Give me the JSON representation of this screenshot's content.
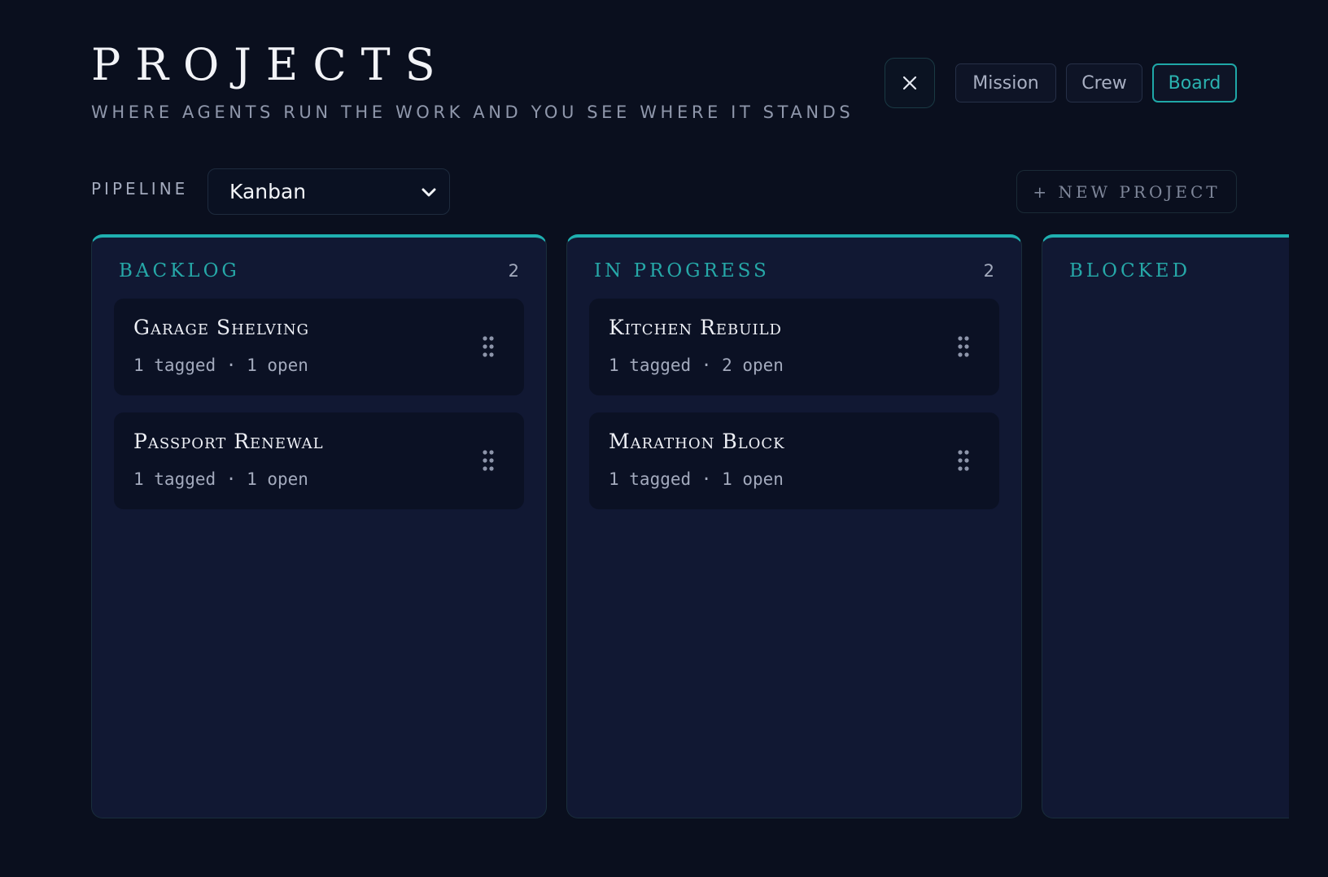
{
  "header": {
    "title": "PROJECTS",
    "subtitle": "WHERE AGENTS RUN THE WORK AND YOU SEE WHERE IT STANDS"
  },
  "nav": {
    "close_icon": "close-icon",
    "buttons": [
      {
        "label": "Mission",
        "active": false
      },
      {
        "label": "Crew",
        "active": false
      },
      {
        "label": "Board",
        "active": true
      }
    ]
  },
  "toolbar": {
    "pipeline_label": "PIPELINE",
    "pipeline_value": "Kanban",
    "new_project_label": "+ NEW PROJECT"
  },
  "colors": {
    "accent": "#1fb0b0",
    "background": "#0a0f1e",
    "column_bg": "#111833",
    "card_bg": "#0b1124"
  },
  "columns": [
    {
      "title": "BACKLOG",
      "count": "2",
      "cards": [
        {
          "title": "Garage Shelving",
          "meta": "1 tagged · 1 open"
        },
        {
          "title": "Passport Renewal",
          "meta": "1 tagged · 1 open"
        }
      ]
    },
    {
      "title": "IN PROGRESS",
      "count": "2",
      "cards": [
        {
          "title": "Kitchen Rebuild",
          "meta": "1 tagged · 2 open"
        },
        {
          "title": "Marathon Block",
          "meta": "1 tagged · 1 open"
        }
      ]
    },
    {
      "title": "BLOCKED",
      "count": "",
      "cards": []
    }
  ]
}
